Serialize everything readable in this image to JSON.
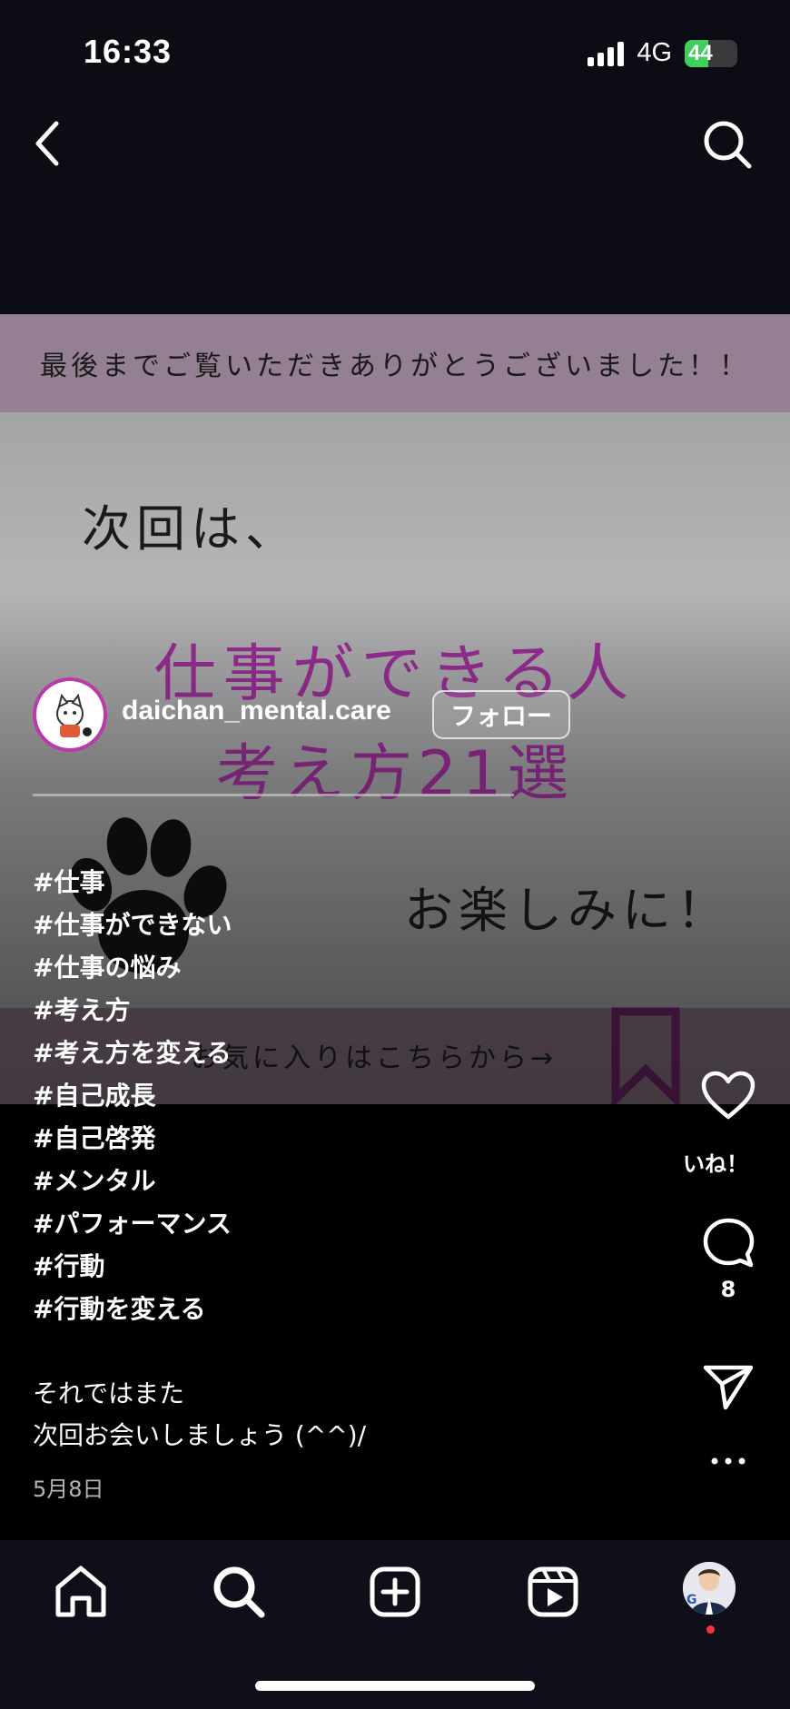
{
  "status_bar": {
    "time": "16:33",
    "network": "4G",
    "battery_level": 44,
    "battery_label": "44"
  },
  "nav": {
    "back_icon": "chevron-left-icon",
    "search_icon": "search-icon"
  },
  "post_image": {
    "banner_text": "最後までご覧いただきありがとうございました！！",
    "next_text": "次回は、",
    "title_line1": "仕事ができる人",
    "title_line2": "考え方21選",
    "enjoy_text": "お楽しみに！",
    "footer_text": "お気に入りはこちらから→",
    "colors": {
      "banner": "#957f92",
      "title": "#9b2f98",
      "footer": "#6e5d6a"
    }
  },
  "author": {
    "username": "daichan_mental.care",
    "follow_label": "フォロー",
    "avatar_ring_color": "#b93aa8"
  },
  "caption": {
    "hashtags": [
      "#仕事",
      "#仕事ができない",
      "#仕事の悩み",
      "#考え方",
      "#考え方を変える",
      "#自己成長",
      "#自己啓発",
      "#メンタル",
      "#パフォーマンス",
      "#行動",
      "#行動を変える"
    ],
    "line1": "それではまた",
    "line2": "次回お会いしましょう (^^)/",
    "date": "5月8日"
  },
  "actions": {
    "like_label": "いね！",
    "comment_count": "8"
  },
  "tabbar": {
    "items": [
      "home-icon",
      "search-icon",
      "add-icon",
      "reels-icon",
      "profile-avatar"
    ],
    "notification_dot_color": "#ff3040"
  }
}
